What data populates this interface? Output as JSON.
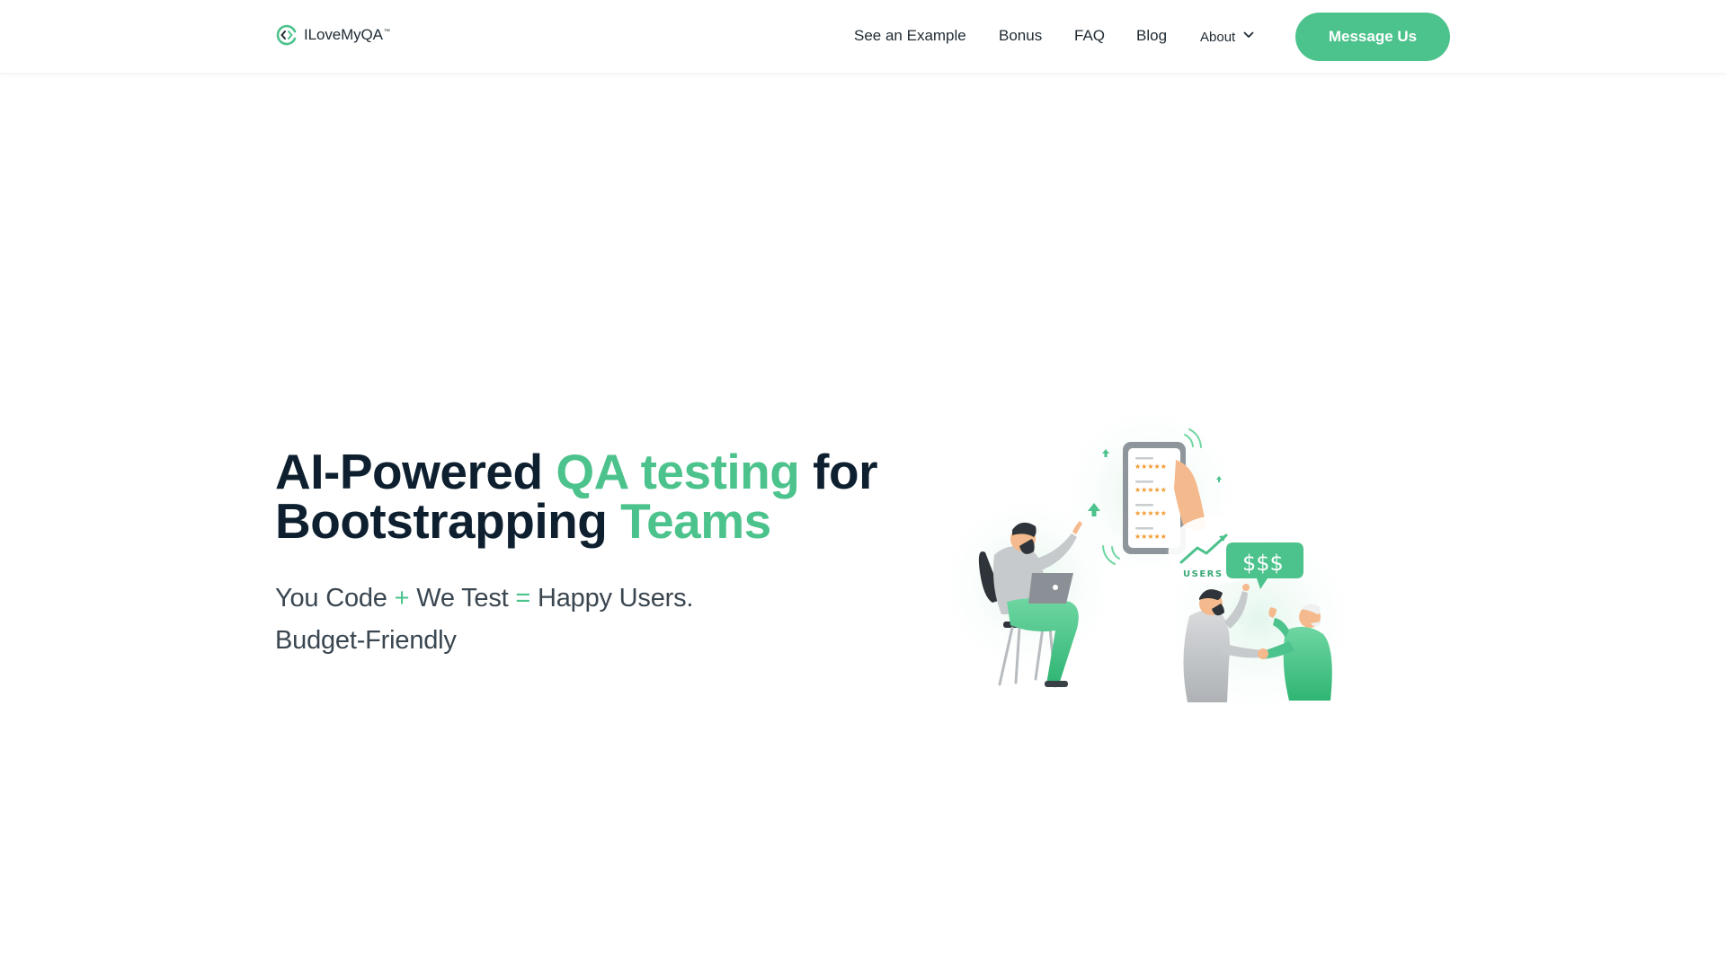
{
  "header": {
    "logo": {
      "text": "ILoveMyQA",
      "trademark": "™",
      "icon": "logo-mark-icon"
    },
    "nav": [
      {
        "label": "See an Example"
      },
      {
        "label": "Bonus"
      },
      {
        "label": "FAQ"
      },
      {
        "label": "Blog"
      }
    ],
    "about": {
      "label": "About",
      "icon": "chevron-down-icon"
    },
    "cta_label": "Message Us"
  },
  "hero": {
    "title_part1": "AI-Powered ",
    "title_accent1": "QA testing",
    "title_part2": " for",
    "title_part3": "Bootstrapping ",
    "title_accent2": "Teams",
    "tagline": {
      "code": "You Code",
      "plus": "+",
      "test": "We Test",
      "equals": "=",
      "result": "Happy Users."
    },
    "budget": "Budget-Friendly"
  },
  "illustration": {
    "users_label": "USERS",
    "money_label": "$$$"
  },
  "colors": {
    "accent": "#4cc28c",
    "heading": "#0e2030",
    "body_text": "#3a4650",
    "star": "#f29a2e"
  }
}
